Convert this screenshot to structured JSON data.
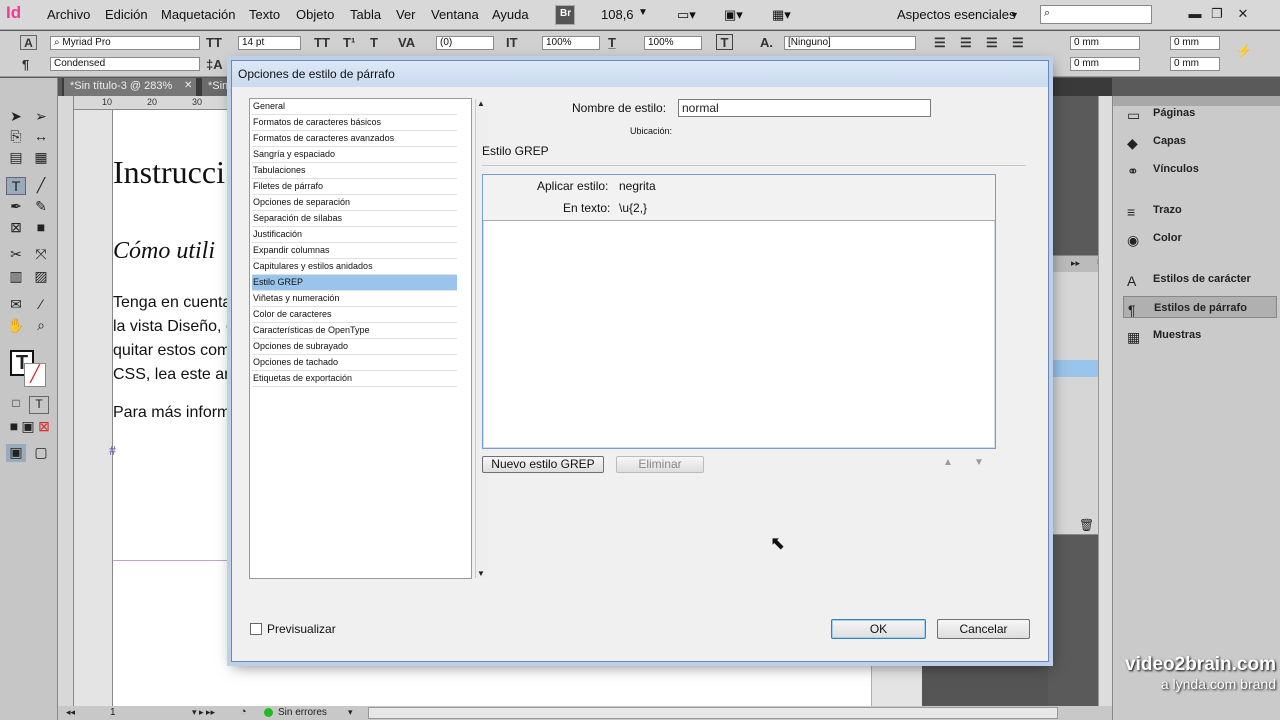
{
  "app": {
    "logo": "Id",
    "menus": [
      "Archivo",
      "Edición",
      "Maquetación",
      "Texto",
      "Objeto",
      "Tabla",
      "Ver",
      "Ventana",
      "Ayuda"
    ],
    "bridge_label": "Br",
    "zoom": "108,6",
    "workspace": "Aspectos esenciales"
  },
  "control_bar": {
    "font_family": "Myriad Pro",
    "font_style": "Condensed",
    "font_size": "14 pt",
    "tracking": "(0)",
    "vscale": "100%",
    "hscale": "100%",
    "char_style": "[Ninguno]",
    "indent_1": "0 mm",
    "indent_2": "0 mm",
    "indent_3": "0 mm",
    "indent_4": "0 mm"
  },
  "tabs": [
    "*Sin título-3 @ 283%",
    "*Sin"
  ],
  "ruler": {
    "top": [
      "10",
      "20",
      "30"
    ]
  },
  "document": {
    "heading": "Instrucci",
    "subheading": "Cómo utili",
    "lines": [
      "Tenga en cuenta qu",
      "la vista Diseño, eche",
      "quitar estos comen",
      "CSS, lea este artícul"
    ],
    "more_info": "Para más informaci",
    "cursor_mark": "#"
  },
  "status": {
    "page": "1",
    "errors": "Sin errores"
  },
  "panels": {
    "group1": [
      "Páginas",
      "Capas",
      "Vínculos"
    ],
    "group2": [
      "Trazo",
      "Color"
    ],
    "group3": [
      "Estilos de carácter",
      "Estilos de párrafo",
      "Muestras"
    ]
  },
  "dialog": {
    "title": "Opciones de estilo de párrafo",
    "categories": [
      "General",
      "Formatos de caracteres básicos",
      "Formatos de caracteres avanzados",
      "Sangría y espaciado",
      "Tabulaciones",
      "Filetes de párrafo",
      "Opciones de separación",
      "Separación de sílabas",
      "Justificación",
      "Expandir columnas",
      "Capitulares y estilos anidados",
      "Estilo GREP",
      "Viñetas y numeración",
      "Color de caracteres",
      "Características de OpenType",
      "Opciones de subrayado",
      "Opciones de tachado",
      "Etiquetas de exportación"
    ],
    "selected_category": "Estilo GREP",
    "style_name_label": "Nombre de estilo:",
    "style_name_value": "normal",
    "location_label": "Ubicación:",
    "section_title": "Estilo GREP",
    "apply_style_label": "Aplicar estilo:",
    "apply_style_value": "negrita",
    "in_text_label": "En texto:",
    "in_text_value": "\\u{2,}",
    "new_grep_button": "Nuevo estilo GREP",
    "delete_button": "Eliminar",
    "preview_label": "Previsualizar",
    "ok_button": "OK",
    "cancel_button": "Cancelar"
  },
  "watermark": {
    "line1": "video2brain.com",
    "line2": "a lynda.com brand"
  }
}
